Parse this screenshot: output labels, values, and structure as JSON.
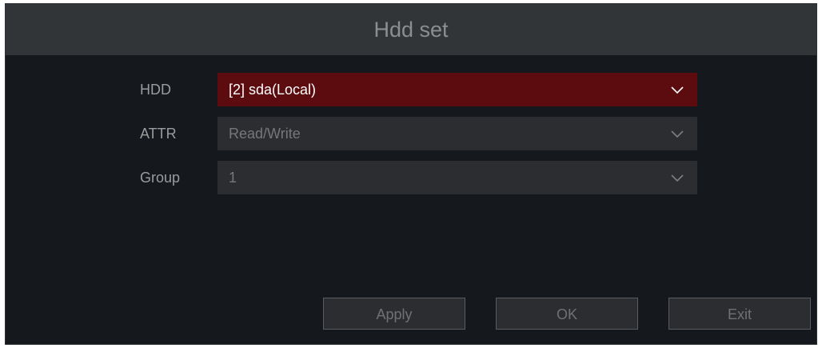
{
  "dialog": {
    "title": "Hdd set"
  },
  "fields": [
    {
      "label": "HDD",
      "value": "[2] sda(Local)",
      "icon": "chevron-down-icon",
      "active": true
    },
    {
      "label": "ATTR",
      "value": "Read/Write",
      "icon": "chevron-down-icon",
      "active": false
    },
    {
      "label": "Group",
      "value": "1",
      "icon": "chevron-down-icon",
      "active": false
    }
  ],
  "buttons": {
    "apply": "Apply",
    "ok": "OK",
    "exit": "Exit"
  },
  "colors": {
    "background": "#15181c",
    "titlebar": "#323538",
    "active_select": "#5c0c0e",
    "select": "#2b2d30"
  }
}
